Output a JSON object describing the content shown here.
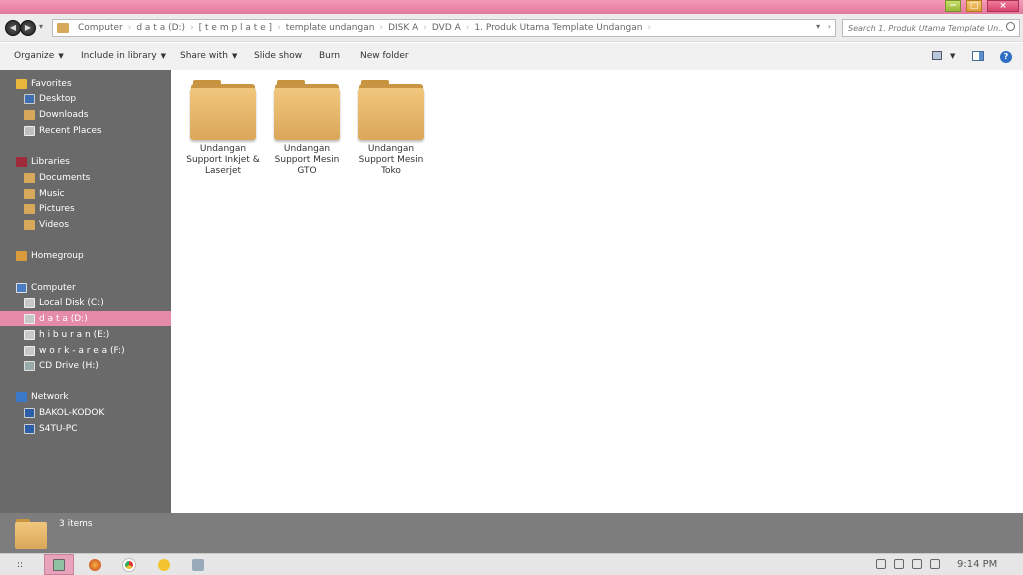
{
  "window": {
    "controls": {
      "minimize": "−",
      "maximize": "□",
      "close": "×"
    }
  },
  "address": {
    "crumbs": [
      "Computer",
      "d a t a (D:)",
      "[ t e m p l a t e ]",
      "template undangan",
      "DISK A",
      "DVD A",
      "1. Produk Utama Template Undangan"
    ],
    "search_placeholder": "Search 1. Produk Utama Template Un..."
  },
  "toolbar": {
    "organize": "Organize",
    "include_in_library": "Include in library",
    "share_with": "Share with",
    "slide_show": "Slide show",
    "burn": "Burn",
    "new_folder": "New folder"
  },
  "sidebar": {
    "favorites": "Favorites",
    "desktop": "Desktop",
    "downloads": "Downloads",
    "recent_places": "Recent Places",
    "libraries": "Libraries",
    "documents": "Documents",
    "music": "Music",
    "pictures": "Pictures",
    "videos": "Videos",
    "homegroup": "Homegroup",
    "computer": "Computer",
    "local_disk": "Local Disk (C:)",
    "data_drive": "d a t a (D:)",
    "hiburan_drive": "h i b u r a n (E:)",
    "workarea_drive": "w o r k - a r e a (F:)",
    "cd_drive": "CD Drive (H:)",
    "network": "Network",
    "pc1": "BAKOL-KODOK",
    "pc2": "S4TU-PC",
    "selected": "d a t a (D:)"
  },
  "content": {
    "folders": [
      {
        "name": "Undangan Support Inkjet & Laserjet"
      },
      {
        "name": "Undangan Support Mesin GTO"
      },
      {
        "name": "Undangan Support Mesin Toko"
      }
    ]
  },
  "details": {
    "item_count": "3 items"
  },
  "taskbar": {
    "start_glyph": "::",
    "clock": "9:14 PM",
    "apps": [
      "explorer-icon",
      "firefox-icon",
      "chrome-icon",
      "smiley-icon",
      "tool-icon"
    ]
  },
  "colors": {
    "accent": "#e68aaa",
    "titlebar": "#f49ab8",
    "sidebar": "#6a6a6a",
    "details": "#7d7d7d",
    "folder": "#dba75a"
  }
}
